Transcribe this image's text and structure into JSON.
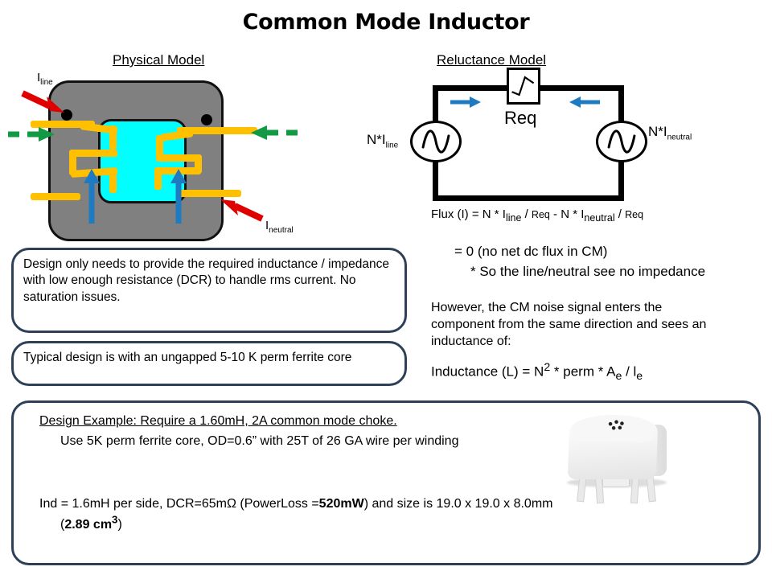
{
  "slide": {
    "title": "Common Mode Inductor"
  },
  "sections": {
    "physical_model_heading": "Physical Model",
    "reluctance_model_heading": "Reluctance Model"
  },
  "physical_model": {
    "label_line": "I",
    "label_line_sub": "line",
    "label_neutral": "I",
    "label_neutral_sub": "neutral",
    "colors": {
      "core": "#808080",
      "window": "#00FFFF",
      "winding": "#FFC000",
      "current_arrow": "#E00000",
      "cm_arrow": "#119944",
      "flux_arrow": "#1F7BC1",
      "outline": "#111111"
    }
  },
  "reluctance_model": {
    "reluctance_label": "Req",
    "source_left_label_main": "N*I",
    "source_left_label_sub": "line",
    "source_right_label_main": "N*I",
    "source_right_label_sub": "neutral",
    "arrow_color": "#1F7BC1"
  },
  "equations": {
    "flux_prefix": "Flux (I) = N * I",
    "flux_sub1": "line",
    "flux_mid1": " / ",
    "flux_req1": "Req",
    "flux_mid2": " - N * I",
    "flux_sub2": "neutral",
    "flux_mid3": " / ",
    "flux_req2": "Req",
    "flux_zero": "= 0 (no net dc flux in CM)",
    "flux_note": "* So the line/neutral see no impedance",
    "cm_note": "However, the CM noise signal enters the component from the same direction and sees an inductance of:",
    "inductance_prefix": "Inductance (L) = N",
    "inductance_sup": "2",
    "inductance_mid": " * perm * A",
    "inductance_sub1": "e",
    "inductance_slash": " / l",
    "inductance_sub2": "e"
  },
  "callouts": {
    "design": "Design only needs to provide the required inductance / impedance with low enough resistance (DCR) to handle rms current. No saturation issues.",
    "typical": "Typical design is with an ungapped 5-10 K perm ferrite core",
    "border_color": "#2e4057"
  },
  "example": {
    "title": "Design Example:  Require a 1.60mH, 2A common mode choke.",
    "subtitle": "Use 5K perm ferrite core, OD=0.6” with 25T of 26 GA wire per winding",
    "result_part1": "Ind = 1.6mH per side, DCR=65mΩ (PowerLoss =",
    "result_bold1": "520mW",
    "result_part2": ") and size is 19.0 x 19.0 x 8.0mm",
    "result_part3": "(",
    "result_bold2": "2.89 cm",
    "result_bold2_sup": "3",
    "result_part4": ")"
  }
}
